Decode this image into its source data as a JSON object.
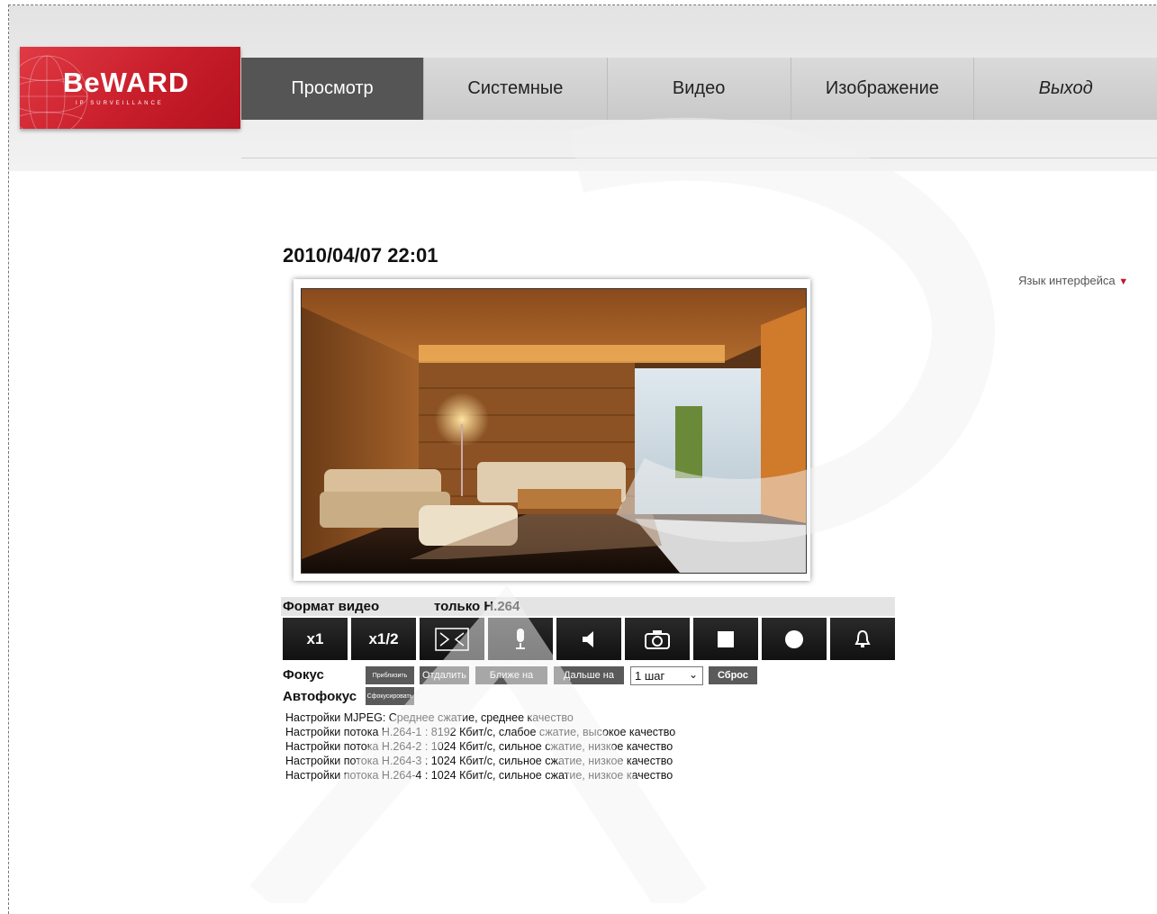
{
  "brand": {
    "name": "BeWARD",
    "tagline": "IP SURVEILLANCE"
  },
  "nav": {
    "items": [
      {
        "label": "Просмотр",
        "active": true
      },
      {
        "label": "Системные"
      },
      {
        "label": "Видео"
      },
      {
        "label": "Изображение"
      },
      {
        "label": "Выход"
      }
    ]
  },
  "language": {
    "label": "Язык интерфейса",
    "arrow": "▼"
  },
  "viewer": {
    "timestamp": "2010/04/07 22:01"
  },
  "format": {
    "label": "Формат видео",
    "value": "только H.264"
  },
  "controls": {
    "zoom_x1": "x1",
    "zoom_half": "x1/2",
    "icons": [
      "fullscreen-icon",
      "microphone-icon",
      "speaker-icon",
      "camera-snapshot-icon",
      "stop-icon",
      "record-icon",
      "alarm-bell-icon"
    ]
  },
  "focus": {
    "label": "Фокус",
    "zoom_in": "Приблизить",
    "zoom_out": "Отдалить",
    "near": "Ближе на",
    "far": "Дальше на",
    "step": "1 шаг",
    "reset": "Сброс"
  },
  "autofocus": {
    "label": "Автофокус",
    "button": "Сфокусировать"
  },
  "stream_settings": [
    "Настройки MJPEG: Среднее сжатие, среднее качество",
    "Настройки потока H.264-1 : 8192 Кбит/с, слабое сжатие, высокое качество",
    "Настройки потока H.264-2 : 1024 Кбит/с, сильное сжатие, низкое качество",
    "Настройки потока H.264-3 : 1024 Кбит/с, сильное сжатие, низкое качество",
    "Настройки потока H.264-4 : 1024 Кбит/с, сильное сжатие, низкое качество"
  ],
  "colors": {
    "brand_red": "#c81e2b",
    "active_tab": "#555555",
    "button_dark": "#1a1a1a"
  }
}
